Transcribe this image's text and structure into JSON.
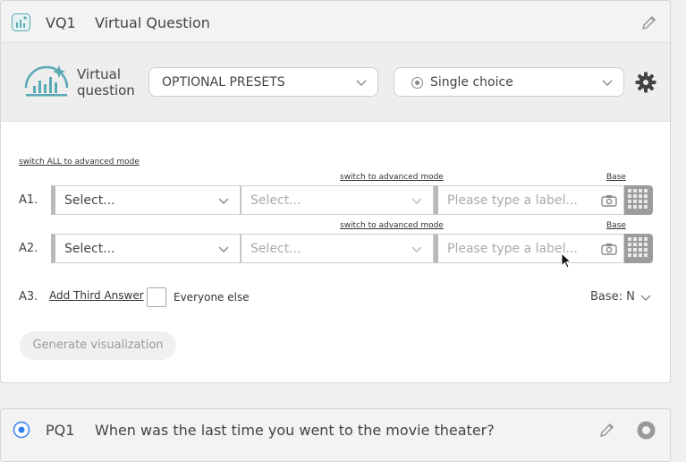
{
  "header": {
    "id": "VQ1",
    "title": "Virtual Question"
  },
  "controls": {
    "logo_label": "Virtual\nquestion",
    "presets_label": "OPTIONAL PRESETS",
    "choice_label": "Single choice"
  },
  "links": {
    "switch_all": "switch ALL to advanced mode",
    "switch_row": "switch to advanced mode",
    "base": "Base"
  },
  "answers": [
    {
      "label": "A1.",
      "select1": "Select...",
      "select2": "Select...",
      "label_placeholder": "Please type a label..."
    },
    {
      "label": "A2.",
      "select1": "Select...",
      "select2": "Select...",
      "label_placeholder": "Please type a label..."
    }
  ],
  "third": {
    "label": "A3.",
    "add_label": "Add Third Answer",
    "everyone_label": "Everyone else",
    "base_label": "Base: N"
  },
  "generate_label": "Generate visualization",
  "next_question": {
    "id": "PQ1",
    "text": "When was the last time you went to the movie theater?"
  },
  "colors": {
    "accent_teal": "#5aa9b5",
    "radio_blue": "#2f80ed"
  }
}
